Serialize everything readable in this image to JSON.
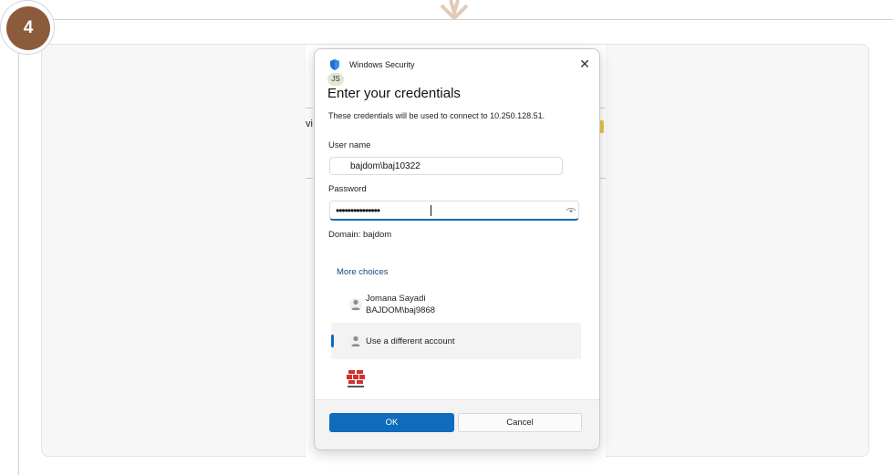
{
  "step": {
    "number": "4"
  },
  "background": {
    "fragment_text": "vi"
  },
  "dialog": {
    "app_name": "Windows Security",
    "avatar_initials": "JS",
    "title": "Enter your credentials",
    "description": "These credentials will be used to connect to 10.250.128.51.",
    "username_label": "User name",
    "username_value": "bajdom\\baj10322",
    "password_label": "Password",
    "password_mask": "•••••••••••••••",
    "domain_text": "Domain: bajdom",
    "more_choices": "More choices",
    "accounts": [
      {
        "name": "Jomana Sayadi",
        "sub": "BAJDOM\\baj9868"
      },
      {
        "name": "Use a different account"
      }
    ],
    "ok_label": "OK",
    "cancel_label": "Cancel"
  },
  "colors": {
    "accent": "#0f6cbd",
    "badge": "#8a5c3b"
  },
  "icons": [
    "arrow-down-icon",
    "windows-security-shield-icon",
    "close-icon",
    "eye-icon",
    "person-icon",
    "fortinet-logo-icon"
  ]
}
